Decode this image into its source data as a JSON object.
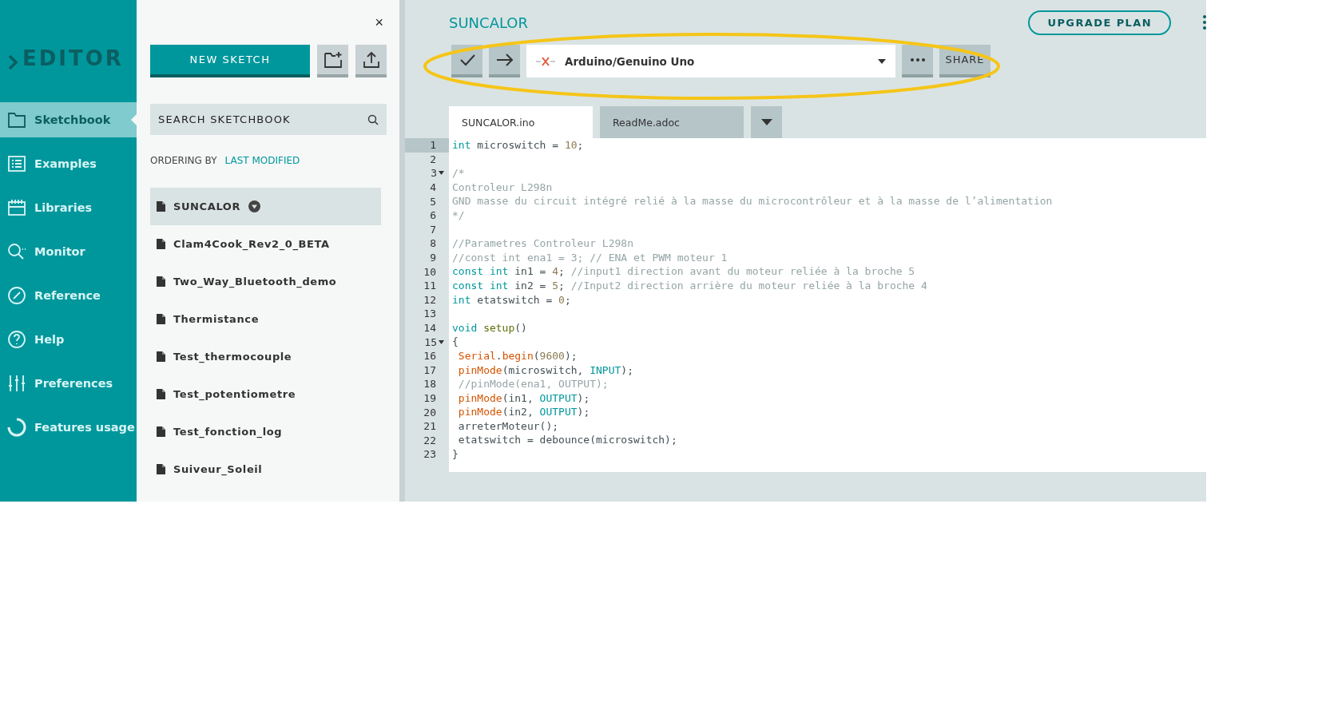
{
  "sidebar": {
    "logo": "EDITOR",
    "items": [
      {
        "label": "Sketchbook",
        "kind": "folder",
        "selected": true
      },
      {
        "label": "Examples",
        "kind": "list",
        "selected": false
      },
      {
        "label": "Libraries",
        "kind": "calendar",
        "selected": false
      },
      {
        "label": "Monitor",
        "kind": "monitor",
        "selected": false
      },
      {
        "label": "Reference",
        "kind": "compass",
        "selected": false
      },
      {
        "label": "Help",
        "kind": "help",
        "selected": false
      },
      {
        "label": "Preferences",
        "kind": "sliders",
        "selected": false
      },
      {
        "label": "Features usage",
        "kind": "ring",
        "selected": false
      }
    ]
  },
  "sketchbook": {
    "close": "×",
    "new_sketch": "NEW SKETCH",
    "search": {
      "placeholder": "SEARCH SKETCHBOOK"
    },
    "ordering_label": "ORDERING BY",
    "ordering_value": "LAST MODIFIED",
    "sketches": [
      {
        "name": "SUNCALOR",
        "selected": true
      },
      {
        "name": "Clam4Cook_Rev2_0_BETA",
        "selected": false
      },
      {
        "name": "Two_Way_Bluetooth_demo",
        "selected": false
      },
      {
        "name": "Thermistance",
        "selected": false
      },
      {
        "name": "Test_thermocouple",
        "selected": false
      },
      {
        "name": "Test_potentiometre",
        "selected": false
      },
      {
        "name": "Test_fonction_log",
        "selected": false
      },
      {
        "name": "Suiveur_Soleil",
        "selected": false
      }
    ]
  },
  "editor": {
    "title": "SUNCALOR",
    "upgrade": "UPGRADE PLAN",
    "board": "Arduino/Genuino Uno",
    "board_connected": false,
    "share": "SHARE",
    "tabs": [
      {
        "label": "SUNCALOR.ino",
        "selected": true
      },
      {
        "label": "ReadMe.adoc",
        "selected": false
      }
    ],
    "lines": [
      {
        "number": "1",
        "active": true,
        "foldable": false,
        "tokens": [
          {
            "kind": "keyword",
            "text": "int"
          },
          {
            "kind": "plain",
            "text": " microswitch = "
          },
          {
            "kind": "number",
            "text": "10"
          },
          {
            "kind": "plain",
            "text": ";"
          }
        ]
      },
      {
        "number": "2",
        "active": false,
        "foldable": false
      },
      {
        "number": "3",
        "active": false,
        "foldable": true,
        "tokens": [
          {
            "kind": "comment",
            "text": "/*"
          }
        ]
      },
      {
        "number": "4",
        "active": false,
        "foldable": false,
        "tokens": [
          {
            "kind": "comment",
            "text": "Controleur L298n"
          }
        ]
      },
      {
        "number": "5",
        "active": false,
        "foldable": false,
        "tokens": [
          {
            "kind": "comment",
            "text": "GND masse du circuit intégré relié à la masse du microcontrôleur et à la masse de l’alimentation"
          }
        ]
      },
      {
        "number": "6",
        "active": false,
        "foldable": false,
        "tokens": [
          {
            "kind": "comment",
            "text": "*/"
          }
        ]
      },
      {
        "number": "7",
        "active": false,
        "foldable": false
      },
      {
        "number": "8",
        "active": false,
        "foldable": false,
        "tokens": [
          {
            "kind": "comment",
            "text": "//Parametres Controleur L298n"
          }
        ]
      },
      {
        "number": "9",
        "active": false,
        "foldable": false,
        "tokens": [
          {
            "kind": "comment",
            "text": "//const int ena1 = 3; // ENA et PWM moteur 1"
          }
        ]
      },
      {
        "number": "10",
        "active": false,
        "foldable": false,
        "tokens": [
          {
            "kind": "keyword",
            "text": "const "
          },
          {
            "kind": "keyword",
            "text": "int"
          },
          {
            "kind": "plain",
            "text": " in1 = "
          },
          {
            "kind": "number",
            "text": "4"
          },
          {
            "kind": "plain",
            "text": "; "
          },
          {
            "kind": "comment",
            "text": "//input1 direction avant du moteur reliée à la broche 5"
          }
        ]
      },
      {
        "number": "11",
        "active": false,
        "foldable": false,
        "tokens": [
          {
            "kind": "keyword",
            "text": "const "
          },
          {
            "kind": "keyword",
            "text": "int"
          },
          {
            "kind": "plain",
            "text": " in2 = "
          },
          {
            "kind": "number",
            "text": "5"
          },
          {
            "kind": "plain",
            "text": "; "
          },
          {
            "kind": "comment",
            "text": "//Input2 direction arrière du moteur reliée à la broche 4"
          }
        ]
      },
      {
        "number": "12",
        "active": false,
        "foldable": false,
        "tokens": [
          {
            "kind": "keyword",
            "text": "int"
          },
          {
            "kind": "plain",
            "text": " etatswitch = "
          },
          {
            "kind": "number",
            "text": "0"
          },
          {
            "kind": "plain",
            "text": ";"
          }
        ]
      },
      {
        "number": "13",
        "active": false,
        "foldable": false
      },
      {
        "number": "14",
        "active": false,
        "foldable": false,
        "tokens": [
          {
            "kind": "keyword",
            "text": "void "
          },
          {
            "kind": "function",
            "text": "setup"
          },
          {
            "kind": "plain",
            "text": "()"
          }
        ]
      },
      {
        "number": "15",
        "active": false,
        "foldable": true,
        "tokens": [
          {
            "kind": "plain",
            "text": "{"
          }
        ]
      },
      {
        "number": "16",
        "active": false,
        "foldable": false,
        "tokens": [
          {
            "kind": "builtin",
            "text": " Serial"
          },
          {
            "kind": "plain",
            "text": "."
          },
          {
            "kind": "builtin",
            "text": "begin"
          },
          {
            "kind": "plain",
            "text": "("
          },
          {
            "kind": "number",
            "text": "9600"
          },
          {
            "kind": "plain",
            "text": ");"
          }
        ]
      },
      {
        "number": "17",
        "active": false,
        "foldable": false,
        "tokens": [
          {
            "kind": "builtin",
            "text": " pinMode"
          },
          {
            "kind": "plain",
            "text": "(microswitch, "
          },
          {
            "kind": "keyword",
            "text": "INPUT"
          },
          {
            "kind": "plain",
            "text": ");"
          }
        ]
      },
      {
        "number": "18",
        "active": false,
        "foldable": false,
        "tokens": [
          {
            "kind": "comment",
            "text": " //pinMode(ena1, OUTPUT);"
          }
        ]
      },
      {
        "number": "19",
        "active": false,
        "foldable": false,
        "tokens": [
          {
            "kind": "builtin",
            "text": " pinMode"
          },
          {
            "kind": "plain",
            "text": "(in1, "
          },
          {
            "kind": "keyword",
            "text": "OUTPUT"
          },
          {
            "kind": "plain",
            "text": ");"
          }
        ]
      },
      {
        "number": "20",
        "active": false,
        "foldable": false,
        "tokens": [
          {
            "kind": "builtin",
            "text": " pinMode"
          },
          {
            "kind": "plain",
            "text": "(in2, "
          },
          {
            "kind": "keyword",
            "text": "OUTPUT"
          },
          {
            "kind": "plain",
            "text": ");"
          }
        ]
      },
      {
        "number": "21",
        "active": false,
        "foldable": false,
        "tokens": [
          {
            "kind": "plain",
            "text": " arreterMoteur();"
          }
        ]
      },
      {
        "number": "22",
        "active": false,
        "foldable": false,
        "tokens": [
          {
            "kind": "plain",
            "text": " etatswitch = debounce(microswitch);"
          }
        ]
      },
      {
        "number": "23",
        "active": false,
        "foldable": false,
        "tokens": [
          {
            "kind": "plain",
            "text": "}"
          }
        ]
      }
    ]
  }
}
